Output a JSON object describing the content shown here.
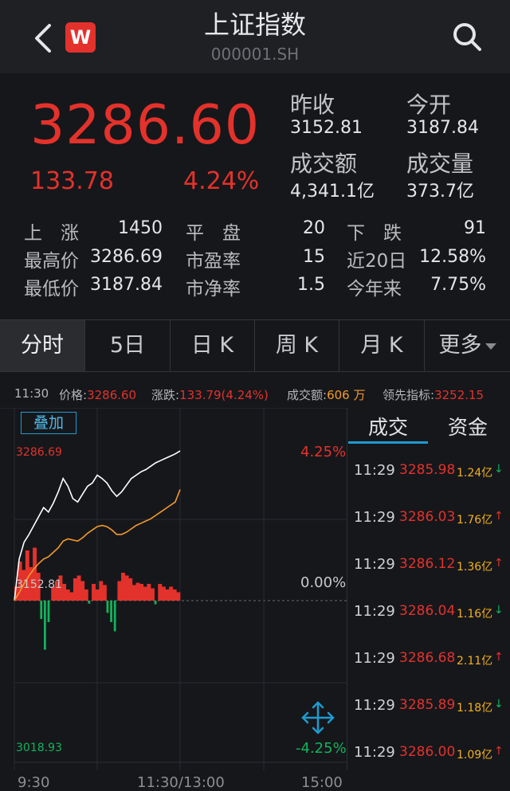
{
  "header": {
    "title": "上证指数",
    "code": "000001.SH",
    "logo_text": "W",
    "logo_color": "#e3322b"
  },
  "quote": {
    "price": "3286.60",
    "change": "133.78",
    "change_pct": "4.24%",
    "prev_close_label": "昨收",
    "prev_close": "3152.81",
    "open_label": "今开",
    "open": "3187.84",
    "turnover_label": "成交额",
    "turnover": "4,341.1亿",
    "volume_label": "成交量",
    "volume": "373.7亿"
  },
  "stats": {
    "row1": [
      {
        "label": "上　涨",
        "value": "1450"
      },
      {
        "label": "平　盘",
        "value": "20"
      },
      {
        "label": "下　跌",
        "value": "91"
      }
    ],
    "row2": [
      {
        "label": "最高价",
        "value": "3286.69"
      },
      {
        "label": "市盈率",
        "value": "15"
      },
      {
        "label": "近20日",
        "value": "12.58%"
      }
    ],
    "row3": [
      {
        "label": "最低价",
        "value": "3187.84"
      },
      {
        "label": "市净率",
        "value": "1.5"
      },
      {
        "label": "今年来",
        "value": "7.75%"
      }
    ]
  },
  "tabs": [
    "分时",
    "5日",
    "日 K",
    "周 K",
    "月 K",
    "更多"
  ],
  "info": {
    "time": "11:30",
    "price_label": "价格:",
    "price": "3286.60",
    "change_label": "涨跌:",
    "change": "133.79(4.24%)",
    "amount_label": "成交额:",
    "amount": "606 万",
    "lead_label": "领先指标:",
    "lead": "3252.15"
  },
  "chart_labels": {
    "overlay_button": "叠加",
    "high": "3286.69",
    "mid": "3152.81",
    "low": "3018.93",
    "high_pct": "4.25%",
    "mid_pct": "0.00%",
    "low_pct": "-4.25%",
    "x_start": "9:30",
    "x_mid": "11:30/13:00",
    "x_end": "15:00"
  },
  "colors": {
    "up": "#e3322b",
    "down": "#13b35c",
    "price_line": "#ffffff",
    "avg_line": "#f39a2a",
    "accent": "#1d9bd1"
  },
  "chart_data": {
    "type": "line",
    "x": [
      "9:30",
      "11:30/13:00",
      "15:00"
    ],
    "ylim": [
      3018.93,
      3286.69
    ],
    "series": [
      {
        "values": [
          3152.81,
          3190,
          3205,
          3212,
          3220,
          3228,
          3236,
          3232,
          3240,
          3250,
          3262,
          3255,
          3244,
          3241,
          3248,
          3255,
          3258,
          3265,
          3262,
          3258,
          3251,
          3246,
          3250,
          3256,
          3262,
          3265,
          3268,
          3270,
          3273,
          3276,
          3278,
          3280,
          3282,
          3284,
          3286.6
        ]
      },
      {
        "values": [
          3152.81,
          3160,
          3168,
          3175,
          3181,
          3186,
          3190,
          3192,
          3196,
          3200,
          3206,
          3208,
          3207,
          3206,
          3209,
          3213,
          3216,
          3219,
          3220,
          3219,
          3216,
          3212,
          3212,
          3214,
          3217,
          3220,
          3222,
          3224,
          3226,
          3229,
          3232,
          3235,
          3238,
          3241,
          3252.15
        ]
      }
    ],
    "volume_bars": [
      {
        "dir": "up",
        "v": 0.25
      },
      {
        "dir": "up",
        "v": 0.7
      },
      {
        "dir": "up",
        "v": 0.55
      },
      {
        "dir": "up",
        "v": 0.9
      },
      {
        "dir": "up",
        "v": 0.6
      },
      {
        "dir": "up",
        "v": 0.95
      },
      {
        "dir": "up",
        "v": 0.5
      },
      {
        "dir": "down",
        "v": 0.3
      },
      {
        "dir": "down",
        "v": 0.8
      },
      {
        "dir": "down",
        "v": 0.35
      },
      {
        "dir": "up",
        "v": 0.25
      },
      {
        "dir": "up",
        "v": 0.35
      },
      {
        "dir": "up",
        "v": 0.45
      },
      {
        "dir": "up",
        "v": 0.3
      },
      {
        "dir": "up",
        "v": 0.2
      },
      {
        "dir": "up",
        "v": 0.15
      },
      {
        "dir": "up",
        "v": 0.4
      },
      {
        "dir": "up",
        "v": 0.45
      },
      {
        "dir": "up",
        "v": 0.35
      },
      {
        "dir": "up",
        "v": 0.2
      },
      {
        "dir": "down",
        "v": 0.05
      },
      {
        "dir": "up",
        "v": 0.3
      },
      {
        "dir": "up",
        "v": 0.2
      },
      {
        "dir": "up",
        "v": 0.35
      },
      {
        "dir": "up",
        "v": 0.28
      },
      {
        "dir": "down",
        "v": 0.2
      },
      {
        "dir": "down",
        "v": 0.35
      },
      {
        "dir": "down",
        "v": 0.5
      },
      {
        "dir": "up",
        "v": 0.35
      },
      {
        "dir": "up",
        "v": 0.5
      },
      {
        "dir": "up",
        "v": 0.45
      },
      {
        "dir": "up",
        "v": 0.4
      },
      {
        "dir": "up",
        "v": 0.28
      },
      {
        "dir": "up",
        "v": 0.32
      },
      {
        "dir": "up",
        "v": 0.3
      },
      {
        "dir": "up",
        "v": 0.25
      },
      {
        "dir": "up",
        "v": 0.3
      },
      {
        "dir": "up",
        "v": 0.22
      },
      {
        "dir": "down",
        "v": 0.06
      },
      {
        "dir": "up",
        "v": 0.3
      },
      {
        "dir": "up",
        "v": 0.25
      },
      {
        "dir": "up",
        "v": 0.2
      },
      {
        "dir": "up",
        "v": 0.25
      },
      {
        "dir": "up",
        "v": 0.2
      },
      {
        "dir": "up",
        "v": 0.15
      }
    ]
  },
  "trades": {
    "tabs": [
      "成交",
      "资金"
    ],
    "rows": [
      {
        "time": "11:29",
        "price": "3285.98",
        "volume": "1.24亿",
        "dir": "down"
      },
      {
        "time": "11:29",
        "price": "3286.03",
        "volume": "1.76亿",
        "dir": "up"
      },
      {
        "time": "11:29",
        "price": "3286.12",
        "volume": "1.36亿",
        "dir": "up"
      },
      {
        "time": "11:29",
        "price": "3286.04",
        "volume": "1.16亿",
        "dir": "down"
      },
      {
        "time": "11:29",
        "price": "3286.68",
        "volume": "2.11亿",
        "dir": "up"
      },
      {
        "time": "11:29",
        "price": "3285.89",
        "volume": "1.18亿",
        "dir": "down"
      },
      {
        "time": "11:29",
        "price": "3286.00",
        "volume": "1.09亿",
        "dir": "up"
      }
    ]
  }
}
